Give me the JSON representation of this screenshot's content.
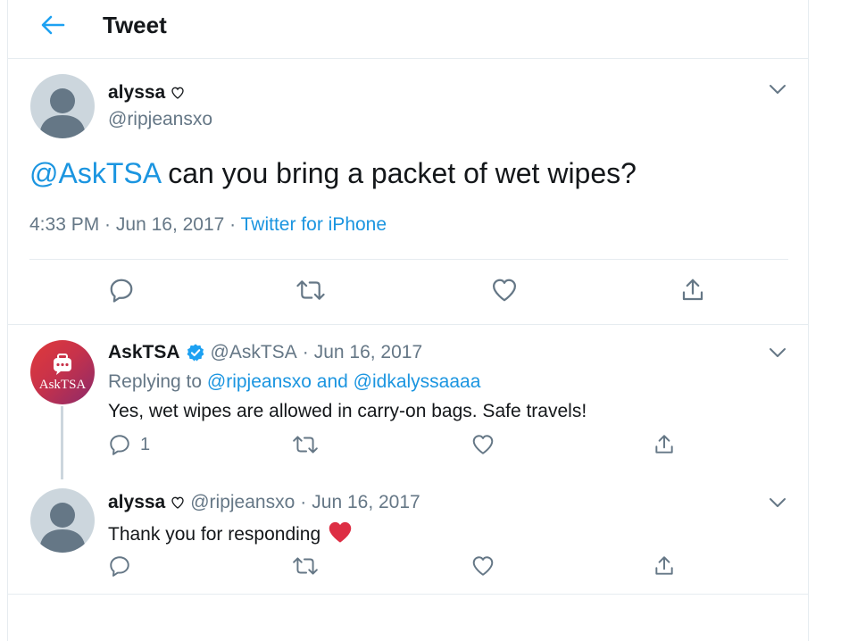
{
  "header": {
    "title": "Tweet",
    "back_icon": "back-arrow-icon"
  },
  "main_tweet": {
    "author_name": "alyssa",
    "name_icon": "heart-outline-icon",
    "author_handle": "@ripjeansxo",
    "text_mention": "@AskTSA",
    "text_body": " can you bring a packet of wet wipes?",
    "time": "4:33 PM",
    "sep1": " · ",
    "date": "Jun 16, 2017",
    "sep2": " · ",
    "source": "Twitter for iPhone"
  },
  "reply_1": {
    "author_name": "AskTSA",
    "verified_icon": "verified-badge-icon",
    "author_handle": "@AskTSA",
    "dot": " · ",
    "date": "Jun 16, 2017",
    "replying_prefix": "Replying to ",
    "replying_users": "@ripjeansxo and @idkalyssaaaa",
    "text": "Yes, wet wipes are allowed in carry-on bags. Safe travels!",
    "avatar_text": "AskTSA",
    "reply_count": "1"
  },
  "reply_2": {
    "author_name": "alyssa",
    "name_icon": "heart-outline-icon",
    "author_handle": "@ripjeansxo",
    "dot": " · ",
    "date": "Jun 16, 2017",
    "text": "Thank you for responding",
    "emoji_icon": "red-heart-icon"
  },
  "colors": {
    "link": "#1b95e0",
    "secondary": "#657786",
    "primary_text": "#14171a",
    "divider": "#e6ecf0",
    "heart_emoji": "#e0245e"
  }
}
